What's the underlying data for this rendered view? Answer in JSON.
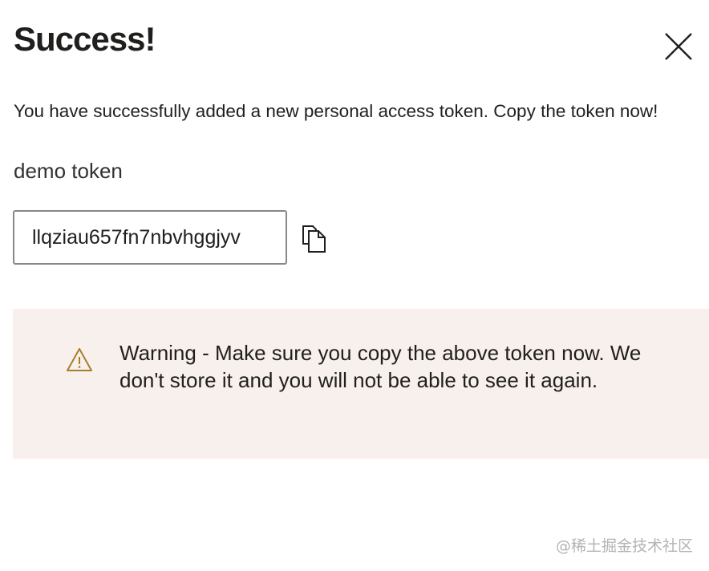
{
  "dialog": {
    "title": "Success!",
    "message": "You have successfully added a new personal access token. Copy the token now!",
    "token_name": "demo token",
    "token_value": "llqziau657fn7nbvhggjyv",
    "close_icon": "close-icon",
    "copy_icon": "copy-icon"
  },
  "warning": {
    "icon": "warning-icon",
    "text": "Warning - Make sure you copy the above token now. We don't store it and you will not be able to see it again.",
    "icon_color": "#a87e2b",
    "background_color": "#f8f0ec"
  },
  "watermark": {
    "text": "@稀土掘金技术社区"
  }
}
